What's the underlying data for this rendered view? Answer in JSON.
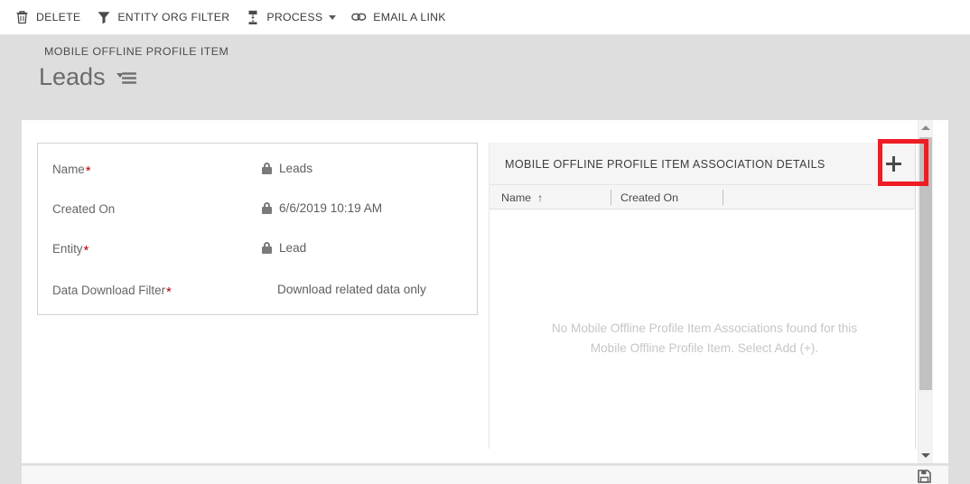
{
  "commandbar": {
    "items": [
      {
        "label": "DELETE",
        "icon": "trash-icon",
        "has_caret": false
      },
      {
        "label": "ENTITY ORG FILTER",
        "icon": "filter-funnel-icon",
        "has_caret": false
      },
      {
        "label": "PROCESS",
        "icon": "process-flow-icon",
        "has_caret": true
      },
      {
        "label": "EMAIL A LINK",
        "icon": "link-chain-icon",
        "has_caret": false
      }
    ]
  },
  "header": {
    "entity_type": "MOBILE OFFLINE PROFILE ITEM",
    "record_title": "Leads",
    "form_selector_icon": "form-selector-icon"
  },
  "form": {
    "fields": [
      {
        "label": "Name",
        "required": true,
        "value": "Leads",
        "locked": true
      },
      {
        "label": "Created On",
        "required": false,
        "value": "6/6/2019  10:19 AM",
        "locked": true
      },
      {
        "label": "Entity",
        "required": true,
        "value": "Lead",
        "locked": true
      },
      {
        "label": "Data Download Filter",
        "required": true,
        "value": "Download related data only",
        "locked": false
      }
    ],
    "required_marker": "*"
  },
  "grid": {
    "title": "MOBILE OFFLINE PROFILE ITEM ASSOCIATION DETAILS",
    "add_button_label": "+",
    "add_button_icon": "plus-icon",
    "columns": [
      {
        "label": "Name",
        "sort": "ascending",
        "sort_glyph": "↑"
      },
      {
        "label": "Created On",
        "sort": "none",
        "sort_glyph": ""
      }
    ],
    "empty_message_line1": "No Mobile Offline Profile Item Associations found for this",
    "empty_message_line2": "Mobile Offline Profile Item. Select Add (+)."
  },
  "scrollbar": {
    "up_arrow_icon": "chevron-up-icon",
    "down_arrow_icon": "chevron-down-icon"
  },
  "footer": {
    "save_icon": "save-floppy-icon"
  },
  "annotation": {
    "target": "add-association-button",
    "color": "#ee1c25"
  },
  "colors": {
    "page_background": "#dedede",
    "content_background": "#ffffff",
    "panel_header": "#f5f5f5",
    "required_star": "#b40000",
    "annotation_red": "#ee1c25"
  }
}
